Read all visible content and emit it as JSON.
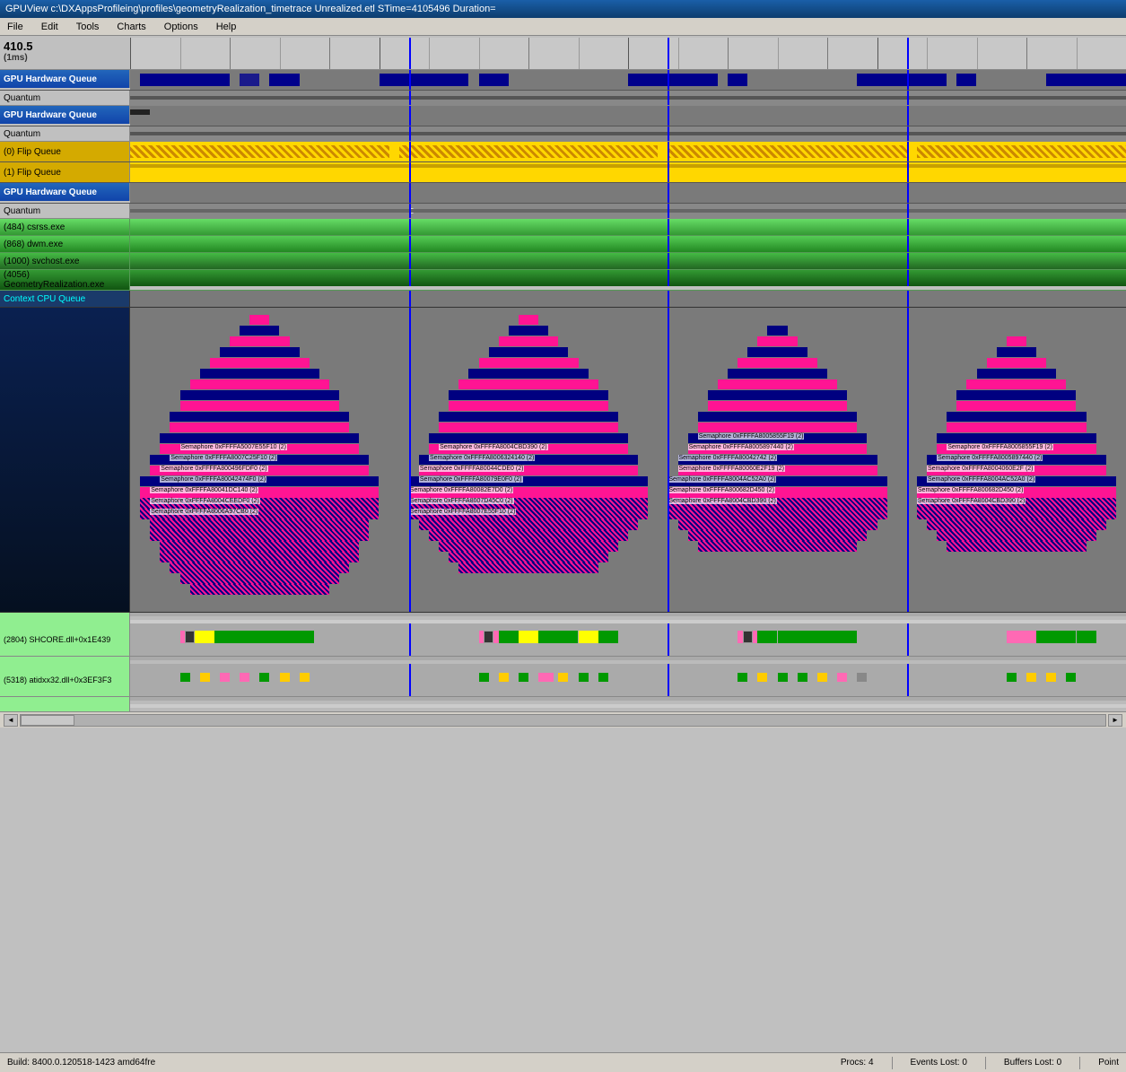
{
  "titlebar": {
    "text": "GPUView c:\\DXAppsProfileing\\profiles\\geometryRealization_timetrace Unrealized.etl STime=4105496 Duration="
  },
  "menubar": {
    "items": [
      "File",
      "Edit",
      "Tools",
      "Charts",
      "Options",
      "Help"
    ]
  },
  "ruler": {
    "value": "410.5",
    "unit": "(1ms)"
  },
  "tracks": {
    "gpu_hw_queue_1": "GPU Hardware Queue",
    "quantum_1": "Quantum",
    "gpu_hw_queue_2": "GPU Hardware Queue",
    "quantum_2": "Quantum",
    "flip_queue_0": "(0) Flip Queue",
    "flip_queue_1": "(1) Flip Queue",
    "gpu_hw_queue_3": "GPU Hardware Queue",
    "quantum_3": "Quantum",
    "csrss": "(484) csrss.exe",
    "dwm": "(868) dwm.exe",
    "svchost": "(1000) svchost.exe",
    "geomreal": "(4056) GeometryRealization.exe",
    "context_cpu": "Context CPU Queue",
    "shcore": "(2804) SHCORE.dll+0x1E439",
    "atidxx": "(5318) atidxx32.dll+0x3EF3F3"
  },
  "semaphores": [
    "Semaphore 0xFFFFA5007E55F10 (2)",
    "Semaphore 0xFFFFA8007C25F10 (2)",
    "Semaphore 0xFFFFA800496FDF0 (2)",
    "Semaphore 0xFFFFA80042474F0 (2)",
    "Semaphore 0xFFFFA80041DC140 (2)",
    "Semaphore 0xFFFFA8004CEEDF0 (2)",
    "Semaphore 0xFFFFA8006A97CB0 (2)",
    "Semaphore 0xFFFFA8004CBD390 (2)",
    "Semaphore 0xFFFFA8006324140 (2)",
    "Semaphore 0xFFFFA80044CDE0 (2)",
    "Semaphore 0xFFFFA80079E0F0 (2)",
    "Semaphore 0xFFFFA80082E7D0 (2)",
    "Semaphore 0xFFFFA8007D45C0 (2)",
    "Semaphore 0xFFFFA8007E55F10 (2)",
    "Semaphore 0xFFFFA8005855F19 (2)",
    "Semaphore 0xFFFFA8005897440 (2)",
    "Semaphore 0xFFFFA80042742 (2)",
    "Semaphore 0xFFFFA80060E2F19 (2)",
    "Semaphore 0xFFFFA8004AC52A0 (2)",
    "Semaphore 0xFFFFA800682D450 (2)",
    "Semaphore 0xFFFFA8004CBD390 (2)"
  ],
  "statusbar": {
    "build": "Build: 8400.0.120518-1423  amd64fre",
    "procs": "Procs: 4",
    "events_lost": "Events Lost: 0",
    "buffers_lost": "Buffers Lost: 0",
    "point": "Point"
  }
}
